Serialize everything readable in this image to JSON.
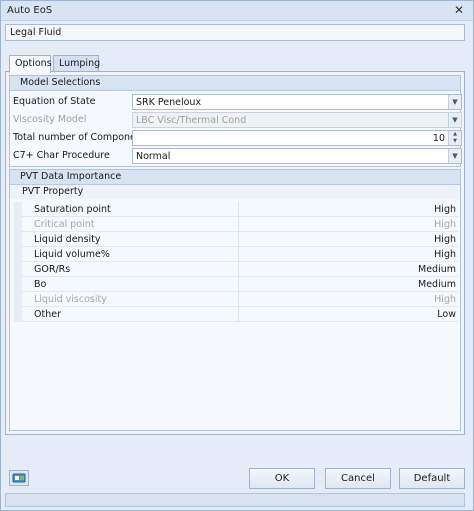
{
  "window": {
    "title": "Auto EoS",
    "close_glyph": "✕"
  },
  "fluid_name": "Legal Fluid",
  "tabs": [
    {
      "label": "Options",
      "active": true
    },
    {
      "label": "Lumping",
      "active": false
    }
  ],
  "model_selections": {
    "header": "Model Selections",
    "equation_of_state": {
      "label": "Equation of State",
      "value": "SRK Peneloux"
    },
    "viscosity_model": {
      "label": "Viscosity Model",
      "value": "LBC Visc/Thermal Cond",
      "disabled": true
    },
    "total_components": {
      "label": "Total number of Components",
      "value": "10"
    },
    "c7_char_procedure": {
      "label": "C7+ Char Procedure",
      "value": "Normal"
    }
  },
  "pvt_importance": {
    "header": "PVT Data Importance",
    "column_header": "PVT Property",
    "rows": [
      {
        "property": "Saturation point",
        "importance": "High",
        "disabled": false
      },
      {
        "property": "Critical point",
        "importance": "High",
        "disabled": true
      },
      {
        "property": "Liquid density",
        "importance": "High",
        "disabled": false
      },
      {
        "property": "Liquid volume%",
        "importance": "High",
        "disabled": false
      },
      {
        "property": "GOR/Rs",
        "importance": "Medium",
        "disabled": false
      },
      {
        "property": "Bo",
        "importance": "Medium",
        "disabled": false
      },
      {
        "property": "Liquid viscosity",
        "importance": "High",
        "disabled": true
      },
      {
        "property": "Other",
        "importance": "Low",
        "disabled": false
      }
    ]
  },
  "footer": {
    "ok_label": "OK",
    "cancel_label": "Cancel",
    "default_label": "Default",
    "help_icon": "help-icon"
  }
}
